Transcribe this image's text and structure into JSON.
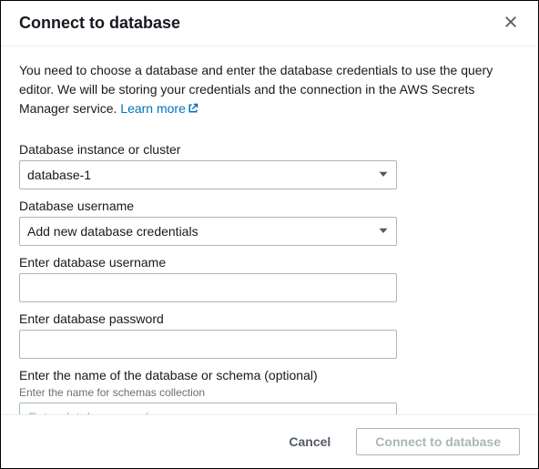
{
  "header": {
    "title": "Connect to database"
  },
  "description": {
    "text_part1": "You need to choose a database and enter the database credentials to use the query editor. We will be storing your credentials and the connection in the AWS Secrets Manager service. ",
    "link_text": "Learn more"
  },
  "form": {
    "instance": {
      "label": "Database instance or cluster",
      "selected": "database-1"
    },
    "username_select": {
      "label": "Database username",
      "selected": "Add new database credentials"
    },
    "username_input": {
      "label": "Enter database username",
      "value": ""
    },
    "password_input": {
      "label": "Enter database password",
      "value": ""
    },
    "schema_input": {
      "label": "Enter the name of the database or schema (optional)",
      "hint": "Enter the name for schemas collection",
      "placeholder": "Enter database or schema name",
      "value": ""
    }
  },
  "footer": {
    "cancel": "Cancel",
    "submit": "Connect to database"
  }
}
